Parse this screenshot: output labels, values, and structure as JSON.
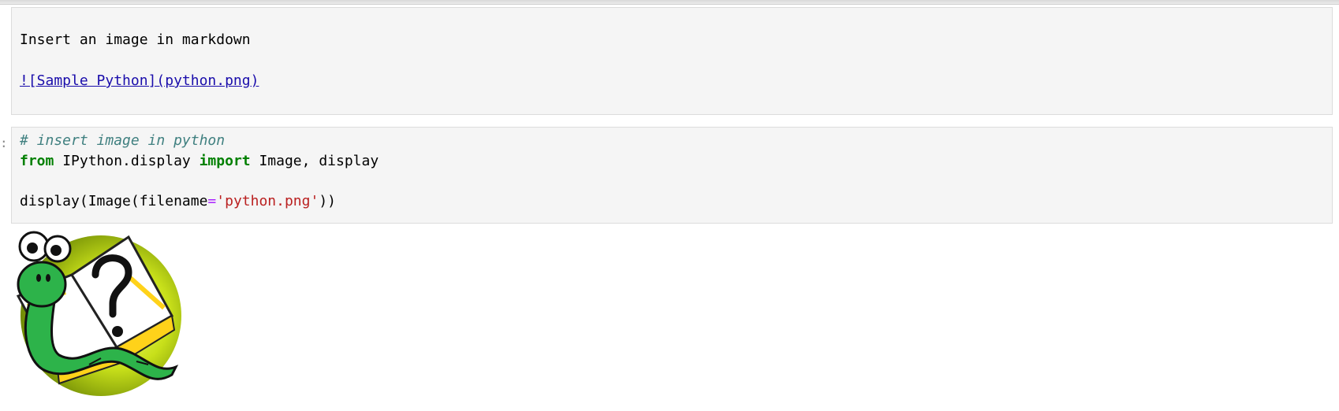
{
  "markdown_cell": {
    "text_line": "Insert an image in markdown",
    "link_text": "![Sample Python](python.png)"
  },
  "code_cell": {
    "comment": "# insert image in python",
    "line2": {
      "kw_from": "from",
      "module": " IPython.display ",
      "kw_import": "import",
      "names": " Image, display"
    },
    "line4": {
      "call_start": "display(Image(filename",
      "equals": "=",
      "string": "'python.png'",
      "call_end": "))"
    }
  },
  "output": {
    "image_icon": "python-help-snake-icon",
    "colors": {
      "snake": "#2db34a",
      "disc": "#c8e01a",
      "book": "#ffd21a"
    }
  }
}
